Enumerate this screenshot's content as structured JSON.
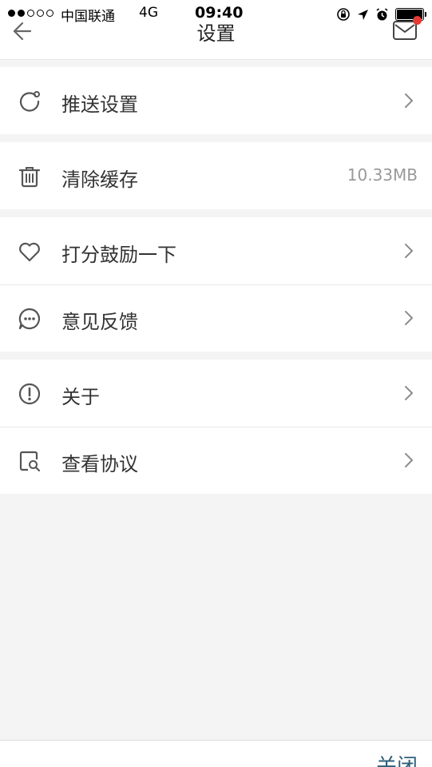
{
  "status_bar": {
    "carrier": "中国联通",
    "network": "4G",
    "time": "09:40"
  },
  "nav": {
    "title": "设置",
    "back_icon": "arrow-left-icon",
    "mail_icon": "mail-icon"
  },
  "settings": {
    "push": {
      "label": "推送设置",
      "icon": "refresh-icon"
    },
    "clear_cache": {
      "label": "清除缓存",
      "value": "10.33MB",
      "icon": "trash-icon"
    },
    "rate": {
      "label": "打分鼓励一下",
      "icon": "heart-icon"
    },
    "feedback": {
      "label": "意见反馈",
      "icon": "chat-bubble-icon"
    },
    "about": {
      "label": "关于",
      "icon": "info-circle-icon"
    },
    "agreement": {
      "label": "查看协议",
      "icon": "document-search-icon"
    }
  },
  "bottom": {
    "close_label": "关闭"
  },
  "colors": {
    "background": "#f4f4f4",
    "accent": "#2f5f7a",
    "badge": "#e53935",
    "secondary_text": "#999999"
  }
}
